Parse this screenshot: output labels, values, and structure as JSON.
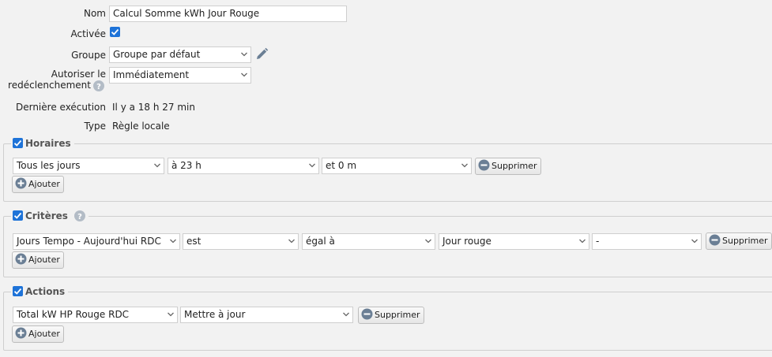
{
  "form": {
    "name_label": "Nom",
    "name_value": "Calcul Somme kWh Jour Rouge",
    "enabled_label": "Activée",
    "enabled_checked": true,
    "group_label": "Groupe",
    "group_value": "Groupe par défaut",
    "retrigger_label_line1": "Autoriser le",
    "retrigger_label_line2": "redéclenchement",
    "retrigger_value": "Immédiatement",
    "last_exec_label": "Dernière exécution",
    "last_exec_value": "Il y a 18 h 27 min",
    "type_label": "Type",
    "type_value": "Règle locale"
  },
  "schedules": {
    "title": "Horaires",
    "checked": true,
    "row": {
      "day": "Tous les jours",
      "hour": "à 23 h",
      "minute": "et 0 m",
      "delete_label": "Supprimer"
    },
    "add_label": "Ajouter"
  },
  "criteria": {
    "title": "Critères",
    "checked": true,
    "row": {
      "device": "Jours Tempo - Aujourd'hui RDC",
      "verb": "est",
      "operator": "égal à",
      "value": "Jour rouge",
      "extra": "-",
      "delete_label": "Supprimer"
    },
    "add_label": "Ajouter"
  },
  "actions": {
    "title": "Actions",
    "checked": true,
    "row": {
      "device": "Total kW HP Rouge RDC",
      "action": "Mettre à jour",
      "delete_label": "Supprimer"
    },
    "add_label": "Ajouter"
  },
  "icons": {
    "edit": "pencil-icon",
    "help": "question-circle-icon",
    "remove": "minus-circle-icon",
    "add": "plus-circle-icon",
    "dropdown": "chevron-down-icon"
  },
  "colors": {
    "accent": "#1e73d8",
    "icon_gray": "#6b7f95",
    "background": "#f2f2f2"
  }
}
